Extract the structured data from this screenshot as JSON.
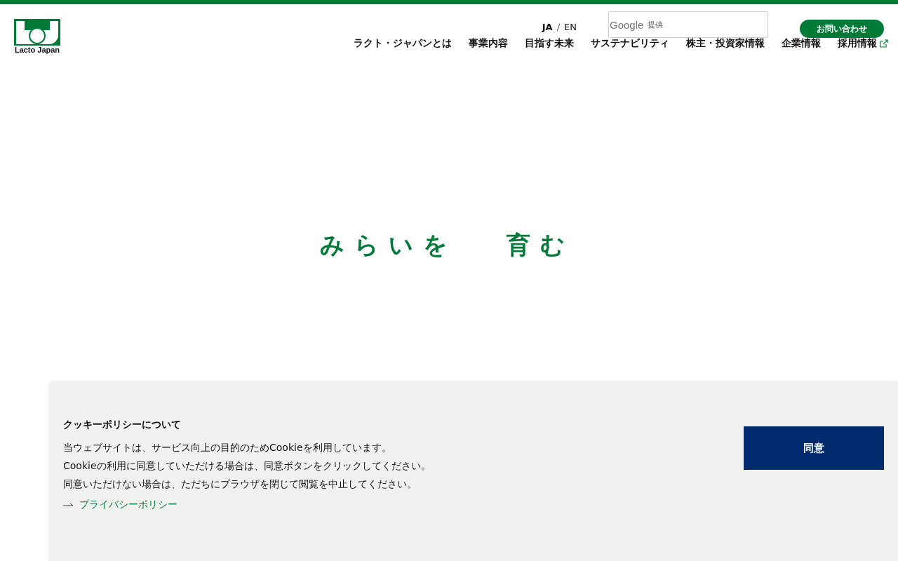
{
  "logo": {
    "text": "Lacto Japan"
  },
  "languages": [
    {
      "label": "JA",
      "selected": true
    },
    {
      "label": "EN",
      "selected": false
    }
  ],
  "language_separator": "/",
  "search": {
    "provider": "Google",
    "provider_note": "提供"
  },
  "contact_button": "お問い合わせ",
  "nav": [
    {
      "label": "ラクト・ジャパンとは",
      "external": false
    },
    {
      "label": "事業内容",
      "external": false
    },
    {
      "label": "目指す未来",
      "external": false
    },
    {
      "label": "サステナビリティ",
      "external": false
    },
    {
      "label": "株主・投資家情報",
      "external": false
    },
    {
      "label": "企業情報",
      "external": false
    },
    {
      "label": "採用情報",
      "external": true
    }
  ],
  "hero": {
    "words": [
      "みらいを",
      "育む"
    ]
  },
  "cookie_banner": {
    "title": "クッキーポリシーについて",
    "lines": [
      "当ウェブサイトは、サービス向上の目的のためCookieを利用しています。",
      "Cookieの利用に同意していただける場合は、同意ボタンをクリックしてください。",
      "同意いただけない場合は、ただちにブラウザを閉じて閲覧を中止してください。"
    ],
    "link": "プライバシーポリシー",
    "button": "同意"
  }
}
